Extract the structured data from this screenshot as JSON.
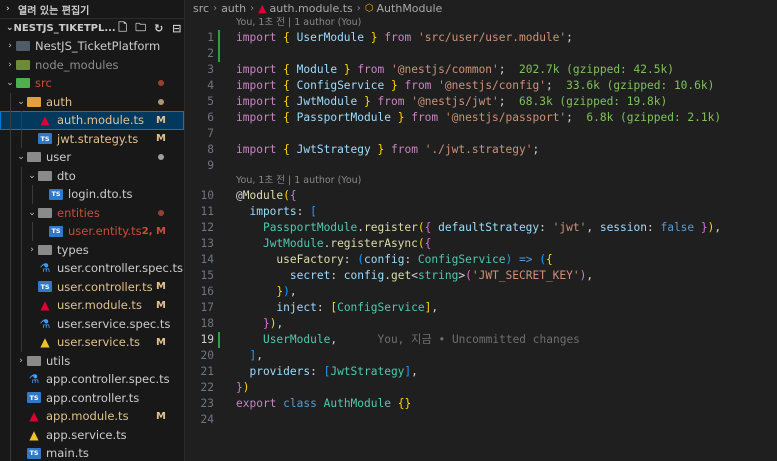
{
  "explorer": {
    "open_editors_label": "열려 있는 편집기",
    "root_label": "NESTJS_TIKETPL...",
    "actions": [
      {
        "icon": "new-file-icon",
        "glyph": "🗋"
      },
      {
        "icon": "new-folder-icon",
        "glyph": "🗀"
      },
      {
        "icon": "refresh-icon",
        "glyph": "↻"
      },
      {
        "icon": "collapse-all-icon",
        "glyph": "⊟"
      }
    ],
    "tree": [
      {
        "label": "NestJS_TicketPlatform",
        "depth": 1,
        "kind": "folder",
        "open": false,
        "color": "#cccccc",
        "folder_color": "#4f5b66",
        "status": "",
        "dot": ""
      },
      {
        "label": "node_modules",
        "depth": 1,
        "kind": "folder",
        "open": false,
        "color": "#8c8c8c",
        "folder_color": "#6d8a3b",
        "status": "",
        "dot": ""
      },
      {
        "label": "src",
        "depth": 1,
        "kind": "folder",
        "open": true,
        "color": "#c74e39",
        "folder_color": "#4caf50",
        "status": "",
        "dot": "#c74e39"
      },
      {
        "label": "auth",
        "depth": 2,
        "kind": "folder",
        "open": true,
        "color": "#e2c08d",
        "folder_color": "#e2a03b",
        "status": "",
        "dot": "#e2c08d"
      },
      {
        "label": "auth.module.ts",
        "depth": 3,
        "kind": "ng",
        "color": "#e2c08d",
        "status": "M",
        "dot": "",
        "selected": true
      },
      {
        "label": "jwt.strategy.ts",
        "depth": 3,
        "kind": "ts",
        "color": "#e2c08d",
        "status": "M",
        "dot": ""
      },
      {
        "label": "user",
        "depth": 2,
        "kind": "folder",
        "open": true,
        "color": "#cccccc",
        "folder_color": "#8a8a8a",
        "status": "",
        "dot": "#cccccc"
      },
      {
        "label": "dto",
        "depth": 3,
        "kind": "folder",
        "open": true,
        "color": "#cccccc",
        "folder_color": "#8a8a8a",
        "status": "",
        "dot": ""
      },
      {
        "label": "login.dto.ts",
        "depth": 4,
        "kind": "ts",
        "color": "#cccccc",
        "status": "",
        "dot": ""
      },
      {
        "label": "entities",
        "depth": 3,
        "kind": "folder",
        "open": true,
        "color": "#c74e39",
        "folder_color": "#8a8a8a",
        "status": "",
        "dot": "#c74e39"
      },
      {
        "label": "user.entity.ts",
        "depth": 4,
        "kind": "ts",
        "color": "#c74e39",
        "status": "2, M",
        "dot": ""
      },
      {
        "label": "types",
        "depth": 3,
        "kind": "folder",
        "open": false,
        "color": "#cccccc",
        "folder_color": "#8a8a8a",
        "status": "",
        "dot": ""
      },
      {
        "label": "user.controller.spec.ts",
        "depth": 3,
        "kind": "test",
        "color": "#cccccc",
        "status": "",
        "dot": ""
      },
      {
        "label": "user.controller.ts",
        "depth": 3,
        "kind": "ts",
        "color": "#e2c08d",
        "status": "M",
        "dot": ""
      },
      {
        "label": "user.module.ts",
        "depth": 3,
        "kind": "ng",
        "color": "#e2c08d",
        "status": "M",
        "dot": ""
      },
      {
        "label": "user.service.spec.ts",
        "depth": 3,
        "kind": "test",
        "color": "#cccccc",
        "status": "",
        "dot": ""
      },
      {
        "label": "user.service.ts",
        "depth": 3,
        "kind": "ngy",
        "color": "#e2c08d",
        "status": "M",
        "dot": ""
      },
      {
        "label": "utils",
        "depth": 2,
        "kind": "folder",
        "open": false,
        "color": "#cccccc",
        "folder_color": "#8a8a8a",
        "status": "",
        "dot": ""
      },
      {
        "label": "app.controller.spec.ts",
        "depth": 2,
        "kind": "test",
        "color": "#cccccc",
        "status": "",
        "dot": ""
      },
      {
        "label": "app.controller.ts",
        "depth": 2,
        "kind": "ts",
        "color": "#cccccc",
        "status": "",
        "dot": ""
      },
      {
        "label": "app.module.ts",
        "depth": 2,
        "kind": "ng",
        "color": "#e2c08d",
        "status": "M",
        "dot": ""
      },
      {
        "label": "app.service.ts",
        "depth": 2,
        "kind": "ngy",
        "color": "#cccccc",
        "status": "",
        "dot": ""
      },
      {
        "label": "main.ts",
        "depth": 2,
        "kind": "ts",
        "color": "#cccccc",
        "status": "",
        "dot": ""
      }
    ]
  },
  "breadcrumb": [
    "src",
    "auth",
    "auth.module.ts",
    "AuthModule"
  ],
  "code_lines": [
    {
      "type": "lens",
      "text": "You, 1초 전 | 1 author (You)"
    },
    {
      "n": "1",
      "gutter": true,
      "tokens": [
        [
          "import",
          "kw"
        ],
        [
          " ",
          "pl"
        ],
        [
          "{",
          "b1"
        ],
        [
          " UserModule ",
          "var"
        ],
        [
          "}",
          "b1"
        ],
        [
          " ",
          "pl"
        ],
        [
          "from",
          "kw"
        ],
        [
          " ",
          "pl"
        ],
        [
          "'src/user/user.module'",
          "str"
        ],
        [
          ";",
          "pl"
        ]
      ]
    },
    {
      "n": "2",
      "gutter": true,
      "tokens": []
    },
    {
      "n": "3",
      "tokens": [
        [
          "import",
          "kw"
        ],
        [
          " ",
          "pl"
        ],
        [
          "{",
          "b1"
        ],
        [
          " Module ",
          "var"
        ],
        [
          "}",
          "b1"
        ],
        [
          " ",
          "pl"
        ],
        [
          "from",
          "kw"
        ],
        [
          " ",
          "pl"
        ],
        [
          "'@nestjs/common'",
          "str"
        ],
        [
          ";",
          "pl"
        ],
        [
          "  202.7k (gzipped: 42.5k)",
          "size"
        ]
      ]
    },
    {
      "n": "4",
      "tokens": [
        [
          "import",
          "kw"
        ],
        [
          " ",
          "pl"
        ],
        [
          "{",
          "b1"
        ],
        [
          " ConfigService ",
          "var"
        ],
        [
          "}",
          "b1"
        ],
        [
          " ",
          "pl"
        ],
        [
          "from",
          "kw"
        ],
        [
          " ",
          "pl"
        ],
        [
          "'@nestjs/config'",
          "str"
        ],
        [
          ";",
          "pl"
        ],
        [
          "  33.6k (gzipped: 10.6k)",
          "size"
        ]
      ]
    },
    {
      "n": "5",
      "tokens": [
        [
          "import",
          "kw"
        ],
        [
          " ",
          "pl"
        ],
        [
          "{",
          "b1"
        ],
        [
          " JwtModule ",
          "var"
        ],
        [
          "}",
          "b1"
        ],
        [
          " ",
          "pl"
        ],
        [
          "from",
          "kw"
        ],
        [
          " ",
          "pl"
        ],
        [
          "'@nestjs/jwt'",
          "str"
        ],
        [
          ";",
          "pl"
        ],
        [
          "  68.3k (gzipped: 19.8k)",
          "size"
        ]
      ]
    },
    {
      "n": "6",
      "tokens": [
        [
          "import",
          "kw"
        ],
        [
          " ",
          "pl"
        ],
        [
          "{",
          "b1"
        ],
        [
          " PassportModule ",
          "var"
        ],
        [
          "}",
          "b1"
        ],
        [
          " ",
          "pl"
        ],
        [
          "from",
          "kw"
        ],
        [
          " ",
          "pl"
        ],
        [
          "'@nestjs/passport'",
          "str"
        ],
        [
          ";",
          "pl"
        ],
        [
          "  6.8k (gzipped: 2.1k)",
          "size"
        ]
      ]
    },
    {
      "n": "7",
      "tokens": []
    },
    {
      "n": "8",
      "tokens": [
        [
          "import",
          "kw"
        ],
        [
          " ",
          "pl"
        ],
        [
          "{",
          "b1"
        ],
        [
          " JwtStrategy ",
          "var"
        ],
        [
          "}",
          "b1"
        ],
        [
          " ",
          "pl"
        ],
        [
          "from",
          "kw"
        ],
        [
          " ",
          "pl"
        ],
        [
          "'./jwt.strategy'",
          "str"
        ],
        [
          ";",
          "pl"
        ]
      ]
    },
    {
      "n": "9",
      "tokens": []
    },
    {
      "type": "lens",
      "text": "You, 1초 전 | 1 author (You)"
    },
    {
      "n": "10",
      "tokens": [
        [
          "@",
          "pl"
        ],
        [
          "Module",
          "fn"
        ],
        [
          "(",
          "b1"
        ],
        [
          "{",
          "b2"
        ]
      ]
    },
    {
      "n": "11",
      "tokens": [
        [
          "  imports",
          "var"
        ],
        [
          ": ",
          "pl"
        ],
        [
          "[",
          "b3"
        ]
      ]
    },
    {
      "n": "12",
      "tokens": [
        [
          "    ",
          "pl"
        ],
        [
          "PassportModule",
          "type"
        ],
        [
          ".",
          "pl"
        ],
        [
          "register",
          "fn"
        ],
        [
          "(",
          "b1"
        ],
        [
          "{",
          "b2"
        ],
        [
          " defaultStrategy",
          "var"
        ],
        [
          ": ",
          "pl"
        ],
        [
          "'jwt'",
          "str"
        ],
        [
          ", ",
          "pl"
        ],
        [
          "session",
          "var"
        ],
        [
          ": ",
          "pl"
        ],
        [
          "false",
          "blue"
        ],
        [
          " ",
          "pl"
        ],
        [
          "}",
          "b2"
        ],
        [
          ")",
          "b1"
        ],
        [
          ",",
          "pl"
        ]
      ]
    },
    {
      "n": "13",
      "tokens": [
        [
          "    ",
          "pl"
        ],
        [
          "JwtModule",
          "type"
        ],
        [
          ".",
          "pl"
        ],
        [
          "registerAsync",
          "fn"
        ],
        [
          "(",
          "b1"
        ],
        [
          "{",
          "b2"
        ]
      ]
    },
    {
      "n": "14",
      "tokens": [
        [
          "      ",
          "pl"
        ],
        [
          "useFactory",
          "fn"
        ],
        [
          ": ",
          "pl"
        ],
        [
          "(",
          "b3"
        ],
        [
          "config",
          "var"
        ],
        [
          ": ",
          "pl"
        ],
        [
          "ConfigService",
          "type"
        ],
        [
          ")",
          "b3"
        ],
        [
          " ",
          "pl"
        ],
        [
          "=>",
          "blue"
        ],
        [
          " ",
          "pl"
        ],
        [
          "(",
          "b3"
        ],
        [
          "{",
          "b1"
        ]
      ]
    },
    {
      "n": "15",
      "tokens": [
        [
          "        ",
          "pl"
        ],
        [
          "secret",
          "var"
        ],
        [
          ": ",
          "pl"
        ],
        [
          "config",
          "var"
        ],
        [
          ".",
          "pl"
        ],
        [
          "get",
          "fn"
        ],
        [
          "<",
          "pl"
        ],
        [
          "string",
          "type"
        ],
        [
          ">",
          "pl"
        ],
        [
          "(",
          "b2"
        ],
        [
          "'JWT_SECRET_KEY'",
          "str"
        ],
        [
          ")",
          "b2"
        ],
        [
          ",",
          "pl"
        ]
      ]
    },
    {
      "n": "16",
      "tokens": [
        [
          "      ",
          "pl"
        ],
        [
          "}",
          "b1"
        ],
        [
          ")",
          "b3"
        ],
        [
          ",",
          "pl"
        ]
      ]
    },
    {
      "n": "17",
      "tokens": [
        [
          "      ",
          "pl"
        ],
        [
          "inject",
          "var"
        ],
        [
          ": ",
          "pl"
        ],
        [
          "[",
          "b1"
        ],
        [
          "ConfigService",
          "type"
        ],
        [
          "]",
          "b1"
        ],
        [
          ",",
          "pl"
        ]
      ]
    },
    {
      "n": "18",
      "tokens": [
        [
          "    ",
          "pl"
        ],
        [
          "}",
          "b2"
        ],
        [
          ")",
          "b1"
        ],
        [
          ",",
          "pl"
        ]
      ]
    },
    {
      "n": "19",
      "gutter": true,
      "active": true,
      "tokens": [
        [
          "    ",
          "pl"
        ],
        [
          "UserModule",
          "type"
        ],
        [
          ",",
          "pl"
        ],
        [
          "      You, 지금 • Uncommitted changes",
          "ghost"
        ]
      ]
    },
    {
      "n": "20",
      "tokens": [
        [
          "  ",
          "pl"
        ],
        [
          "]",
          "b3"
        ],
        [
          ",",
          "pl"
        ]
      ]
    },
    {
      "n": "21",
      "tokens": [
        [
          "  providers",
          "var"
        ],
        [
          ": ",
          "pl"
        ],
        [
          "[",
          "b3"
        ],
        [
          "JwtStrategy",
          "type"
        ],
        [
          "]",
          "b3"
        ],
        [
          ",",
          "pl"
        ]
      ]
    },
    {
      "n": "22",
      "tokens": [
        [
          "}",
          "b2"
        ],
        [
          ")",
          "b1"
        ]
      ]
    },
    {
      "n": "23",
      "tokens": [
        [
          "export",
          "kw"
        ],
        [
          " ",
          "pl"
        ],
        [
          "class",
          "blue"
        ],
        [
          " ",
          "pl"
        ],
        [
          "AuthModule",
          "type"
        ],
        [
          " ",
          "pl"
        ],
        [
          "{}",
          "b1"
        ]
      ]
    },
    {
      "n": "24",
      "tokens": []
    }
  ]
}
